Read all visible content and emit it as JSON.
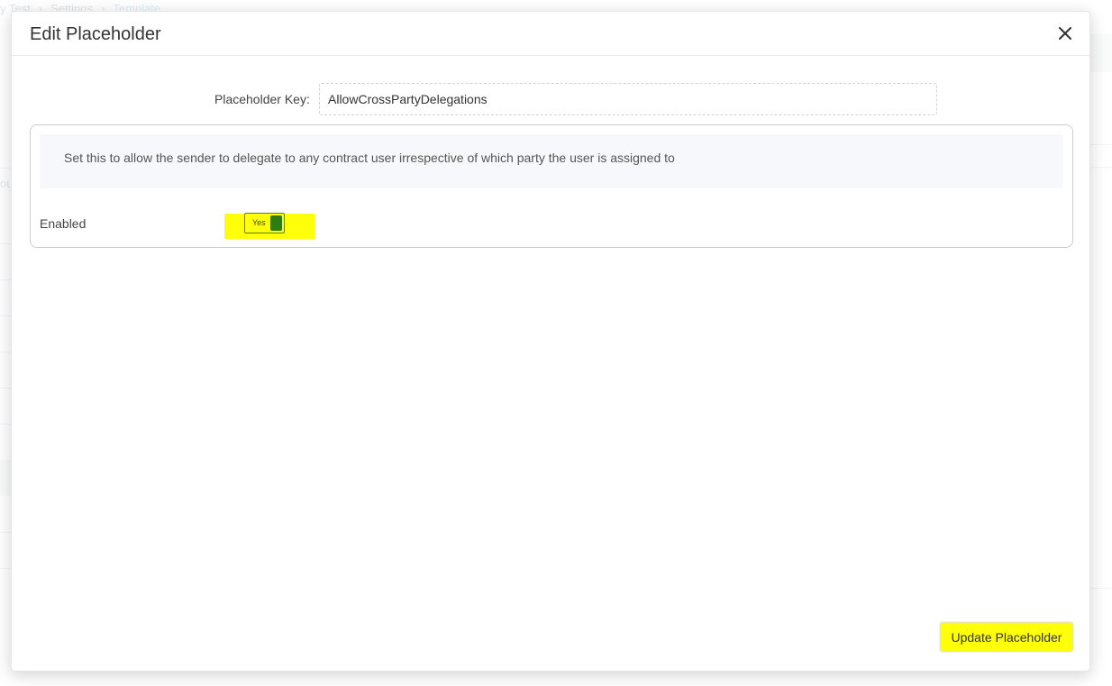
{
  "background": {
    "breadcrumb": [
      "y Test",
      "Settings",
      "Template"
    ],
    "fragment": "ou"
  },
  "modal": {
    "title": "Edit Placeholder",
    "close_icon": "close-icon",
    "placeholder_key": {
      "label": "Placeholder Key:",
      "value": "AllowCrossPartyDelegations"
    },
    "description": "Set this to allow the sender to delegate to any contract user irrespective of which party the user is assigned to",
    "enabled": {
      "label": "Enabled",
      "toggle_text": "Yes",
      "state": true
    },
    "update_button": "Update Placeholder"
  },
  "colors": {
    "highlight": "#ffff0a",
    "toggle_on": "#2e7d12"
  }
}
